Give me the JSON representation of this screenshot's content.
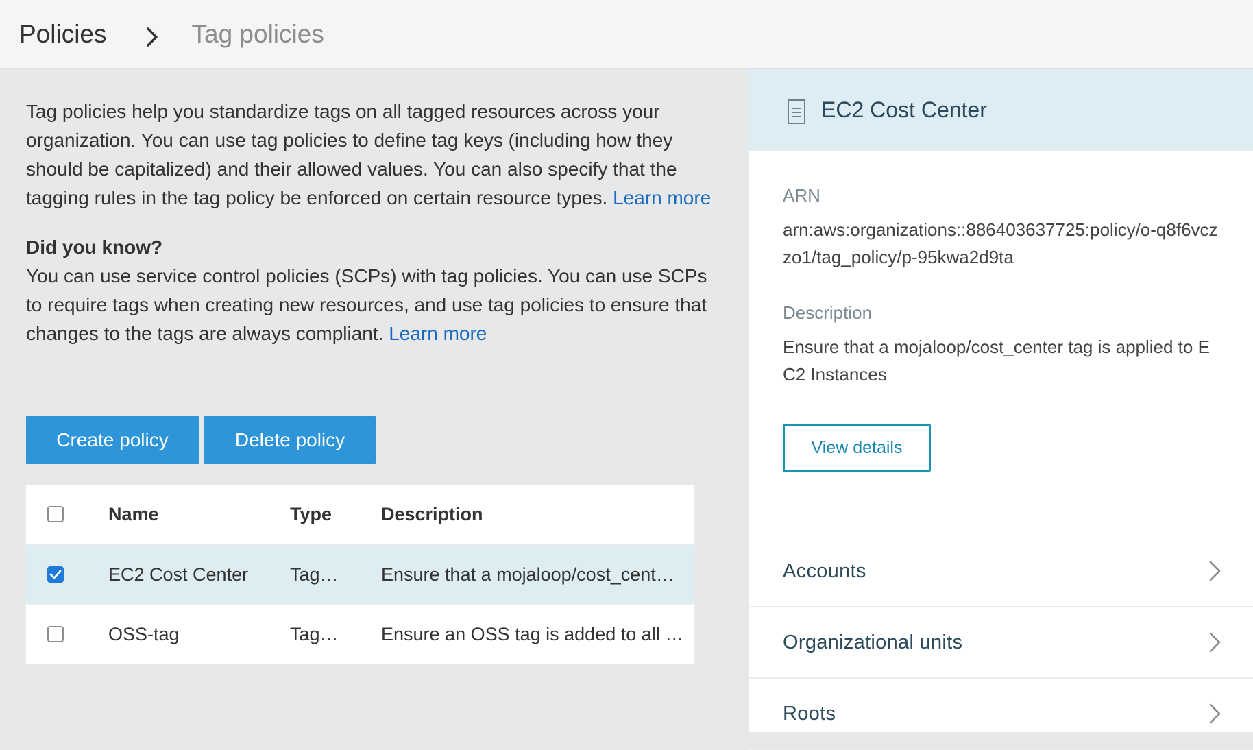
{
  "breadcrumb": {
    "root": "Policies",
    "current": "Tag policies"
  },
  "intro": {
    "text": "Tag policies help you standardize tags on all tagged resources across your organization. You can use tag policies to define tag keys (including how they should be capitalized) and their allowed values. You can also specify that the tagging rules in the tag policy be enforced on certain resource types.",
    "learn_more": "Learn more",
    "dyk_title": "Did you know?",
    "dyk_text": "You can use service control policies (SCPs) with tag policies. You can use SCPs to require tags when creating new resources, and use tag policies to ensure that changes to the tags are always compliant.",
    "dyk_learn_more": "Learn more"
  },
  "actions": {
    "create_label": "Create policy",
    "delete_label": "Delete policy"
  },
  "table": {
    "columns": [
      "Name",
      "Type",
      "Description"
    ],
    "rows": [
      {
        "name": "EC2 Cost Center",
        "type": "Tag…",
        "description": "Ensure that a mojaloop/cost_cent…",
        "checked": true
      },
      {
        "name": "OSS-tag",
        "type": "Tag…",
        "description": "Ensure an OSS tag is added to all …",
        "checked": false
      }
    ]
  },
  "detail": {
    "title": "EC2 Cost Center",
    "arn_label": "ARN",
    "arn_value": "arn:aws:organizations::886403637725:policy/o-q8f6vczzo1/tag_policy/p-95kwa2d9ta",
    "description_label": "Description",
    "description_value": "Ensure that a mojaloop/cost_center tag is applied to EC2 Instances",
    "view_details_label": "View details",
    "nav": [
      "Accounts",
      "Organizational units",
      "Roots"
    ]
  },
  "colors": {
    "primary_button": "#2e96d8",
    "link": "#1a6bbf",
    "selected_row": "#deedf2",
    "detail_header": "#ddedf3",
    "outline_button": "#1995b4"
  }
}
